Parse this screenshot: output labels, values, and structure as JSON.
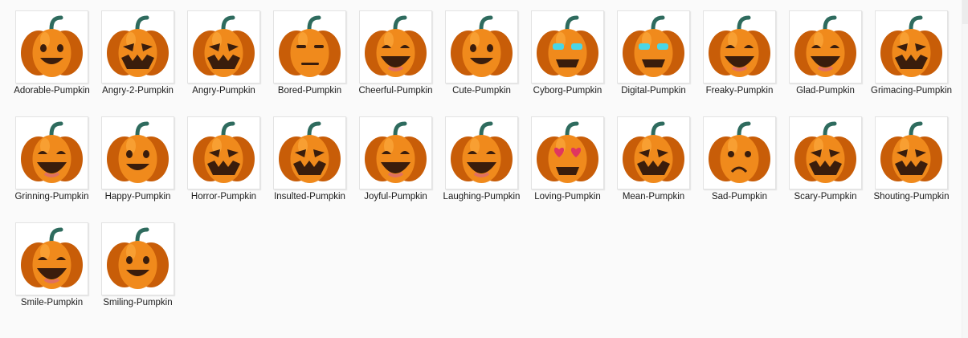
{
  "files": [
    {
      "name": "Adorable-Pumpkin",
      "icon": "adorable-pumpkin-icon"
    },
    {
      "name": "Angry-2-Pumpkin",
      "icon": "angry-2-pumpkin-icon"
    },
    {
      "name": "Angry-Pumpkin",
      "icon": "angry-pumpkin-icon"
    },
    {
      "name": "Bored-Pumpkin",
      "icon": "bored-pumpkin-icon"
    },
    {
      "name": "Cheerful-Pumpkin",
      "icon": "cheerful-pumpkin-icon"
    },
    {
      "name": "Cute-Pumpkin",
      "icon": "cute-pumpkin-icon"
    },
    {
      "name": "Cyborg-Pumpkin",
      "icon": "cyborg-pumpkin-icon"
    },
    {
      "name": "Digital-Pumpkin",
      "icon": "digital-pumpkin-icon"
    },
    {
      "name": "Freaky-Pumpkin",
      "icon": "freaky-pumpkin-icon"
    },
    {
      "name": "Glad-Pumpkin",
      "icon": "glad-pumpkin-icon"
    },
    {
      "name": "Grimacing-Pumpkin",
      "icon": "grimacing-pumpkin-icon"
    },
    {
      "name": "Grinning-Pumpkin",
      "icon": "grinning-pumpkin-icon"
    },
    {
      "name": "Happy-Pumpkin",
      "icon": "happy-pumpkin-icon"
    },
    {
      "name": "Horror-Pumpkin",
      "icon": "horror-pumpkin-icon"
    },
    {
      "name": "Insulted-Pumpkin",
      "icon": "insulted-pumpkin-icon"
    },
    {
      "name": "Joyful-Pumpkin",
      "icon": "joyful-pumpkin-icon"
    },
    {
      "name": "Laughing-Pumpkin",
      "icon": "laughing-pumpkin-icon"
    },
    {
      "name": "Loving-Pumpkin",
      "icon": "loving-pumpkin-icon"
    },
    {
      "name": "Mean-Pumpkin",
      "icon": "mean-pumpkin-icon"
    },
    {
      "name": "Sad-Pumpkin",
      "icon": "sad-pumpkin-icon"
    },
    {
      "name": "Scary-Pumpkin",
      "icon": "scary-pumpkin-icon"
    },
    {
      "name": "Shouting-Pumpkin",
      "icon": "shouting-pumpkin-icon"
    },
    {
      "name": "Smile-Pumpkin",
      "icon": "smile-pumpkin-icon"
    },
    {
      "name": "Smiling-Pumpkin",
      "icon": "smiling-pumpkin-icon"
    }
  ],
  "colors": {
    "pumpkin": "#f08a1c",
    "pumpkin_dark": "#c85d08",
    "pumpkin_light": "#ffb347",
    "stem": "#2e6b5e",
    "face": "#3a1d0c",
    "background": "#fafafa"
  }
}
